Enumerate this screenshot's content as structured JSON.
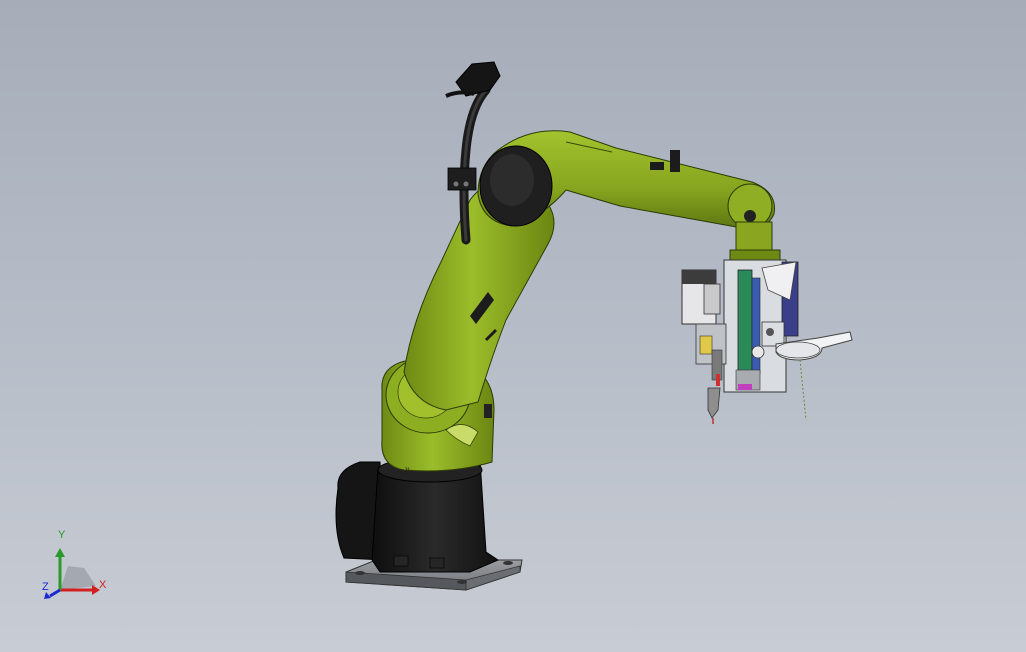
{
  "viewport": {
    "background_top": "#a6adb9",
    "background_bottom": "#c8ccd4"
  },
  "model": {
    "robot_color": "#8aa620",
    "robot_dark": "#5f7412",
    "base_color": "#1c1c1c",
    "plate_color": "#8c8f93"
  },
  "triad": {
    "x_label": "X",
    "y_label": "Y",
    "z_label": "Z",
    "x_color": "#d22020",
    "y_color": "#2a9a2a",
    "z_color": "#1a2ad0"
  }
}
